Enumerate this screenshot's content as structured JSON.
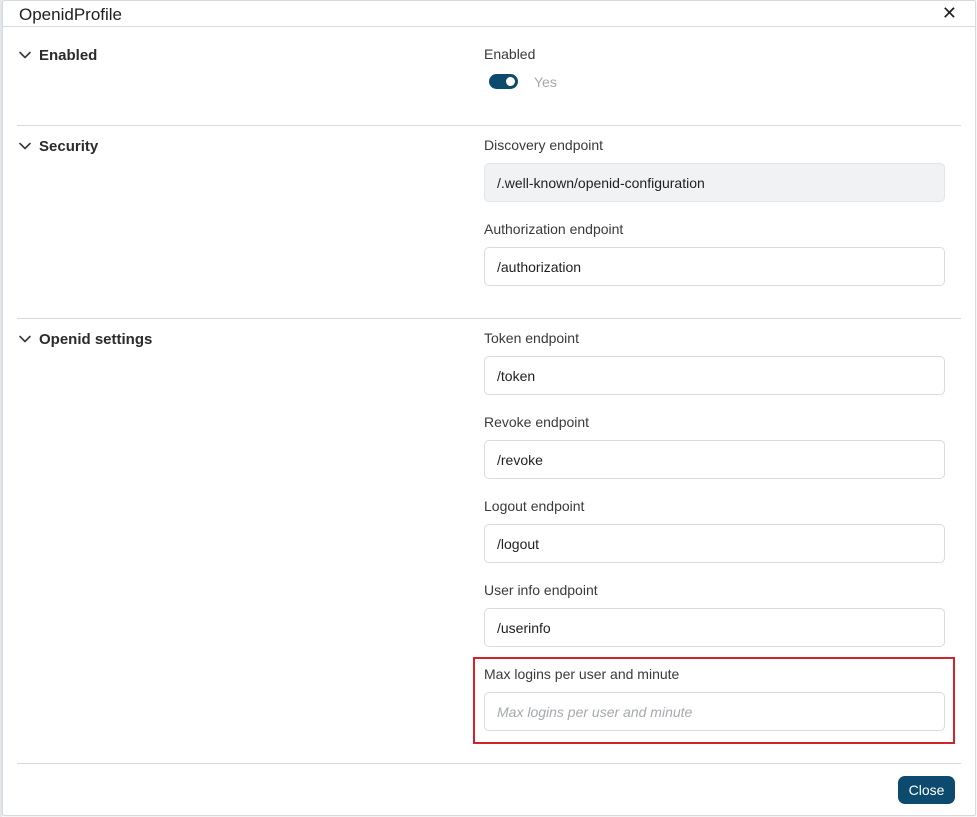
{
  "dialog": {
    "title": "OpenidProfile",
    "close_icon": "close-icon",
    "close_glyph": "✕"
  },
  "sections": {
    "enabled": {
      "title": "Enabled",
      "toggle_label": "Enabled",
      "toggle_state": true,
      "toggle_text": "Yes"
    },
    "security": {
      "title": "Security",
      "discovery": {
        "label": "Discovery endpoint",
        "value": "/.well-known/openid-configuration"
      },
      "authorization": {
        "label": "Authorization endpoint",
        "value": "/authorization"
      }
    },
    "openid_settings": {
      "title": "Openid settings",
      "token": {
        "label": "Token endpoint",
        "value": "/token"
      },
      "revoke": {
        "label": "Revoke endpoint",
        "value": "/revoke"
      },
      "logout": {
        "label": "Logout endpoint",
        "value": "/logout"
      },
      "userinfo": {
        "label": "User info endpoint",
        "value": "/userinfo"
      },
      "max_logins": {
        "label": "Max logins per user and minute",
        "value": "",
        "placeholder": "Max logins per user and minute"
      }
    }
  },
  "footer": {
    "close_label": "Close"
  },
  "colors": {
    "accent": "#0c4a6e",
    "highlight": "#d0232a"
  }
}
